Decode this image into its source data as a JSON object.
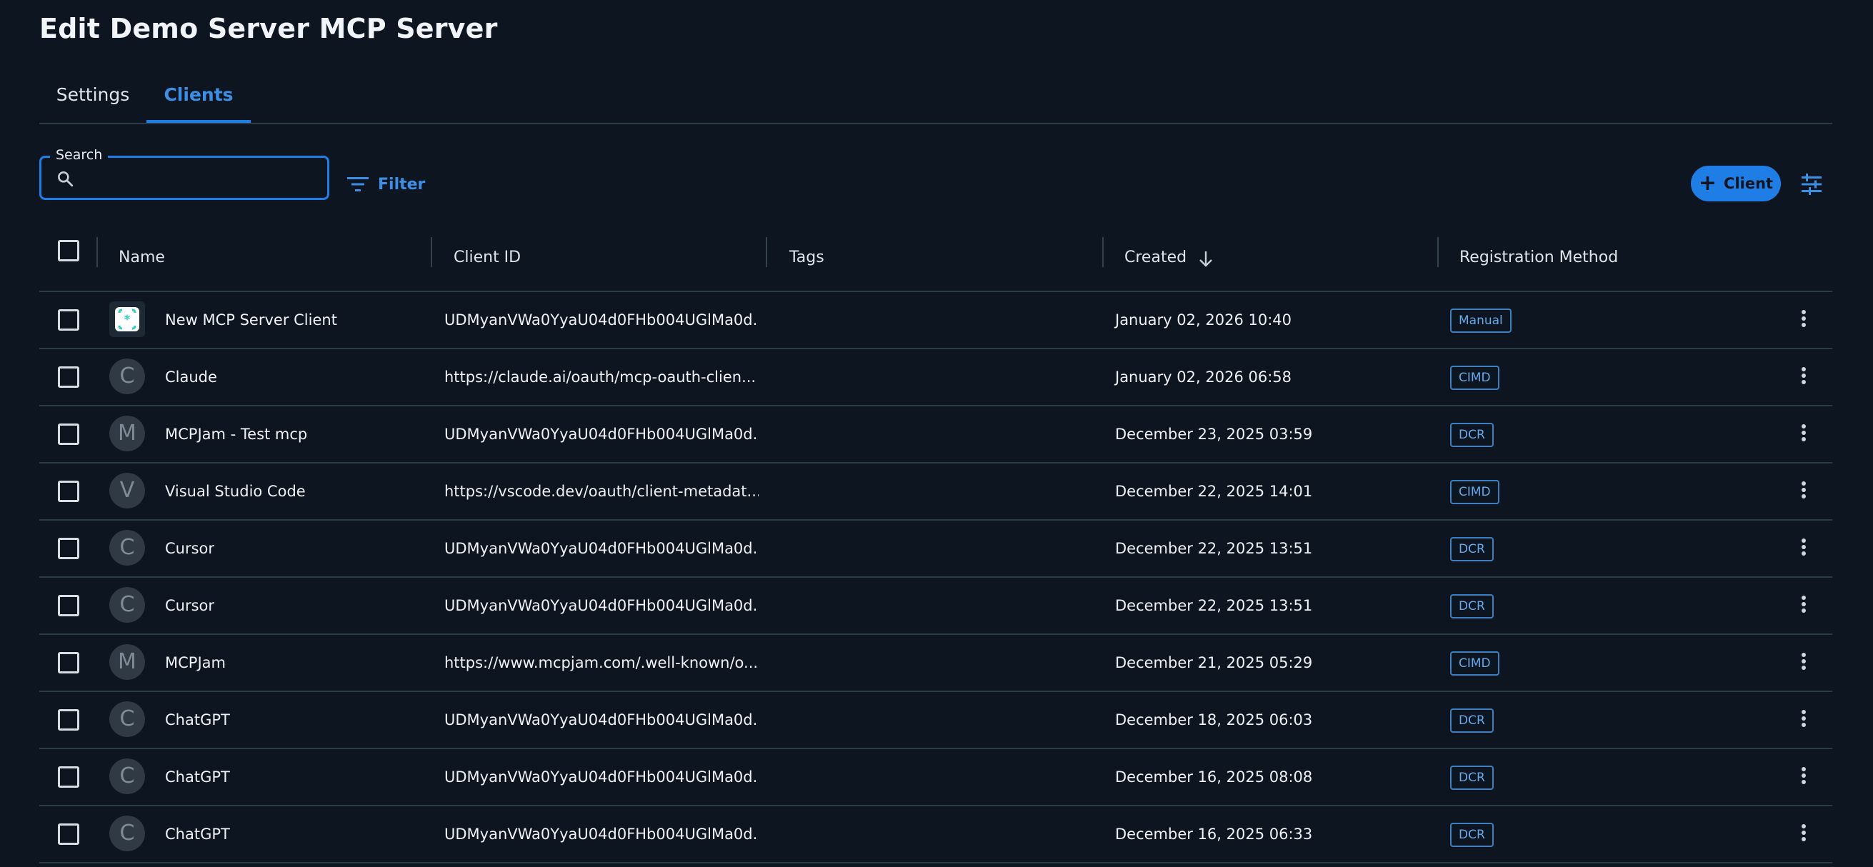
{
  "page": {
    "title": "Edit Demo Server MCP Server"
  },
  "tabs": [
    {
      "label": "Settings",
      "active": false
    },
    {
      "label": "Clients",
      "active": true
    }
  ],
  "toolbar": {
    "search_label": "Search",
    "search_value": "",
    "filter_label": "Filter",
    "add_client_label": "Client"
  },
  "table": {
    "columns": [
      "Name",
      "Client ID",
      "Tags",
      "Created",
      "Registration Method"
    ],
    "sort": {
      "column": "Created",
      "direction": "descending"
    },
    "rows": [
      {
        "avatar": "logo",
        "name": "New MCP Server Client",
        "client_id": "UDMyanVWa0YyaU04d0FHb004UGlMa0d...",
        "tags": "",
        "created": "January 02, 2026 10:40",
        "method": "Manual"
      },
      {
        "avatar": "C",
        "name": "Claude",
        "client_id": "https://claude.ai/oauth/mcp-oauth-clien...",
        "tags": "",
        "created": "January 02, 2026 06:58",
        "method": "CIMD"
      },
      {
        "avatar": "M",
        "name": "MCPJam - Test mcp",
        "client_id": "UDMyanVWa0YyaU04d0FHb004UGlMa0d...",
        "tags": "",
        "created": "December 23, 2025 03:59",
        "method": "DCR"
      },
      {
        "avatar": "V",
        "name": "Visual Studio Code",
        "client_id": "https://vscode.dev/oauth/client-metadat...",
        "tags": "",
        "created": "December 22, 2025 14:01",
        "method": "CIMD"
      },
      {
        "avatar": "C",
        "name": "Cursor",
        "client_id": "UDMyanVWa0YyaU04d0FHb004UGlMa0d...",
        "tags": "",
        "created": "December 22, 2025 13:51",
        "method": "DCR"
      },
      {
        "avatar": "C",
        "name": "Cursor",
        "client_id": "UDMyanVWa0YyaU04d0FHb004UGlMa0d...",
        "tags": "",
        "created": "December 22, 2025 13:51",
        "method": "DCR"
      },
      {
        "avatar": "M",
        "name": "MCPJam",
        "client_id": "https://www.mcpjam.com/.well-known/o...",
        "tags": "",
        "created": "December 21, 2025 05:29",
        "method": "CIMD"
      },
      {
        "avatar": "C",
        "name": "ChatGPT",
        "client_id": "UDMyanVWa0YyaU04d0FHb004UGlMa0d...",
        "tags": "",
        "created": "December 18, 2025 06:03",
        "method": "DCR"
      },
      {
        "avatar": "C",
        "name": "ChatGPT",
        "client_id": "UDMyanVWa0YyaU04d0FHb004UGlMa0d...",
        "tags": "",
        "created": "December 16, 2025 08:08",
        "method": "DCR"
      },
      {
        "avatar": "C",
        "name": "ChatGPT",
        "client_id": "UDMyanVWa0YyaU04d0FHb004UGlMa0d...",
        "tags": "",
        "created": "December 16, 2025 06:33",
        "method": "DCR"
      }
    ]
  },
  "colors": {
    "background": "#0d1520",
    "accent": "#1e7ee6",
    "divider": "#2a3a46",
    "badge": "#64a9ec",
    "logo": "#2fd0c0"
  },
  "icons": [
    "search-icon",
    "filter-icon",
    "plus-icon",
    "column-settings-icon",
    "sort-arrow-down-icon",
    "kebab-menu-icon",
    "client-logo-icon"
  ]
}
